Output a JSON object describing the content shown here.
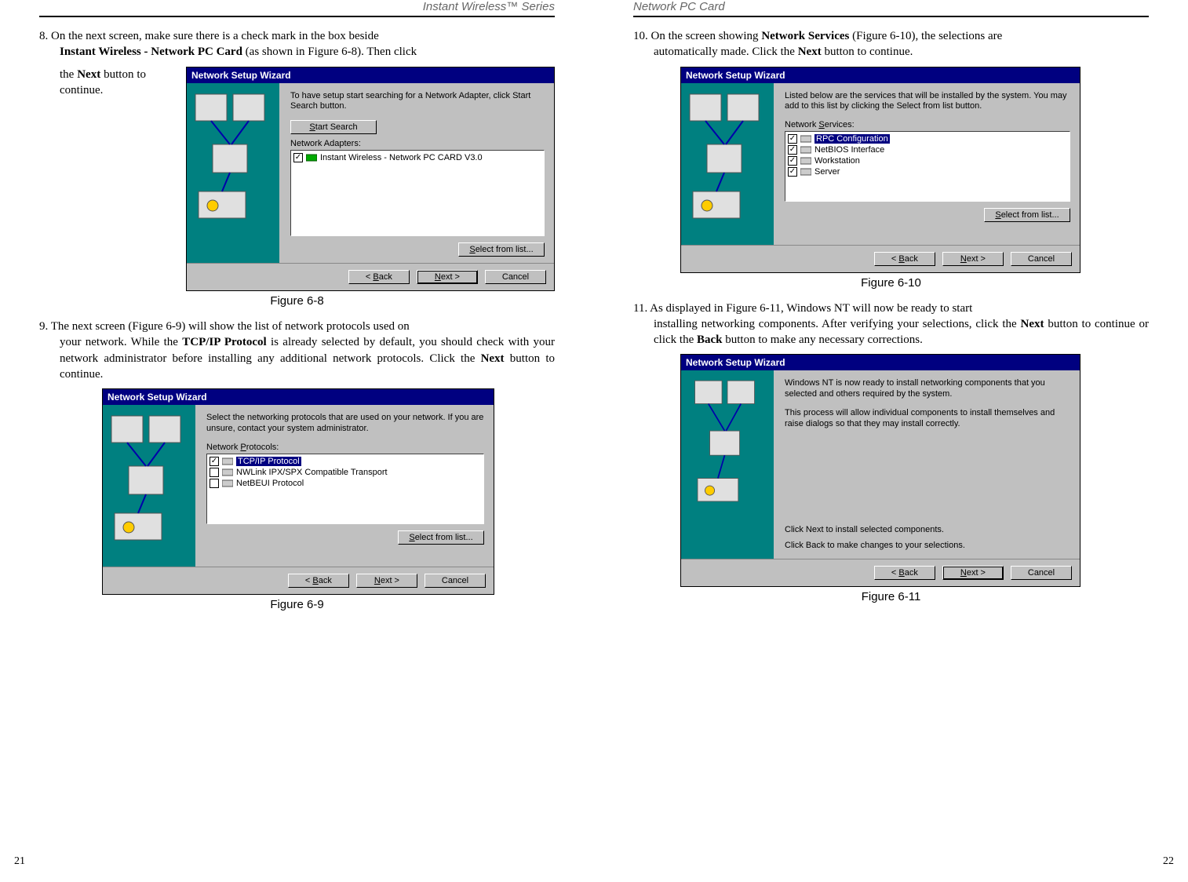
{
  "headers": {
    "left": "Instant Wireless™ Series",
    "right": "Network PC Card"
  },
  "pagenums": {
    "left": "21",
    "right": "22"
  },
  "step8": {
    "num": "8. ",
    "line1a": "On the next screen, make sure there is a check mark in the box beside",
    "line1b": "Instant Wireless - Network PC Card",
    "line1c": " (as shown in Figure 6-8). Then click",
    "side_a": "the ",
    "side_b": "Next",
    "side_c": "button to continue."
  },
  "fig8": {
    "caption": "Figure 6-8",
    "title": "Network Setup Wizard",
    "text": "To have setup start searching for a Network Adapter, click Start Search button.",
    "btn_search": "Start Search",
    "label_adapters": "Network Adapters:",
    "adapter_item": "Instant Wireless - Network PC CARD V3.0",
    "btn_select": "Select from list...",
    "btn_back": "< Back",
    "btn_next": "Next >",
    "btn_cancel": "Cancel"
  },
  "step9": {
    "num": "9. ",
    "first": "The next screen (Figure 6-9) will show the list of network protocols used on",
    "rest_a": "your network. While the ",
    "rest_b": "TCP/IP Protocol",
    "rest_c": " is already selected by default, you should check with your network administrator before installing any additional network protocols. Click the ",
    "rest_d": "Next",
    "rest_e": " button to continue."
  },
  "fig9": {
    "caption": "Figure 6-9",
    "title": "Network Setup Wizard",
    "text": "Select the networking protocols that are used on your network. If you are unsure, contact your system administrator.",
    "label": "Network Protocols:",
    "items": [
      "TCP/IP Protocol",
      "NWLink IPX/SPX Compatible Transport",
      "NetBEUI Protocol"
    ],
    "checked": [
      true,
      false,
      false
    ],
    "btn_select": "Select from list...",
    "btn_back": "< Back",
    "btn_next": "Next >",
    "btn_cancel": "Cancel"
  },
  "step10": {
    "num": "10. ",
    "first": "On the screen showing ",
    "b1": "Network Services",
    "mid": " (Figure 6-10), the selections are",
    "rest_a": "automatically made. Click the ",
    "rest_b": "Next",
    "rest_c": " button to continue."
  },
  "fig10": {
    "caption": "Figure 6-10",
    "title": "Network Setup Wizard",
    "text": "Listed below are the services that will be installed by the system. You may add to this list by clicking the Select from list button.",
    "label": "Network Services:",
    "items": [
      "RPC Configuration",
      "NetBIOS Interface",
      "Workstation",
      "Server"
    ],
    "btn_select": "Select from list...",
    "btn_back": "< Back",
    "btn_next": "Next >",
    "btn_cancel": "Cancel"
  },
  "step11": {
    "num": "11. ",
    "first": "As displayed in Figure 6-11, Windows NT will now be ready to start",
    "rest_a": "installing networking components. After verifying your selections, click the ",
    "rest_b": "Next",
    "rest_c": " button to continue or click the ",
    "rest_d": "Back",
    "rest_e": " button to make any necessary corrections."
  },
  "fig11": {
    "caption": "Figure 6-11",
    "title": "Network Setup Wizard",
    "text1": "Windows NT is now ready to install networking components that you selected and others required by the system.",
    "text2": "This process will allow individual components to install themselves and raise dialogs so that they may install correctly.",
    "text3": "Click Next to install selected components.",
    "text4": "Click Back to make changes to your selections.",
    "btn_back": "< Back",
    "btn_next": "Next >",
    "btn_cancel": "Cancel"
  }
}
